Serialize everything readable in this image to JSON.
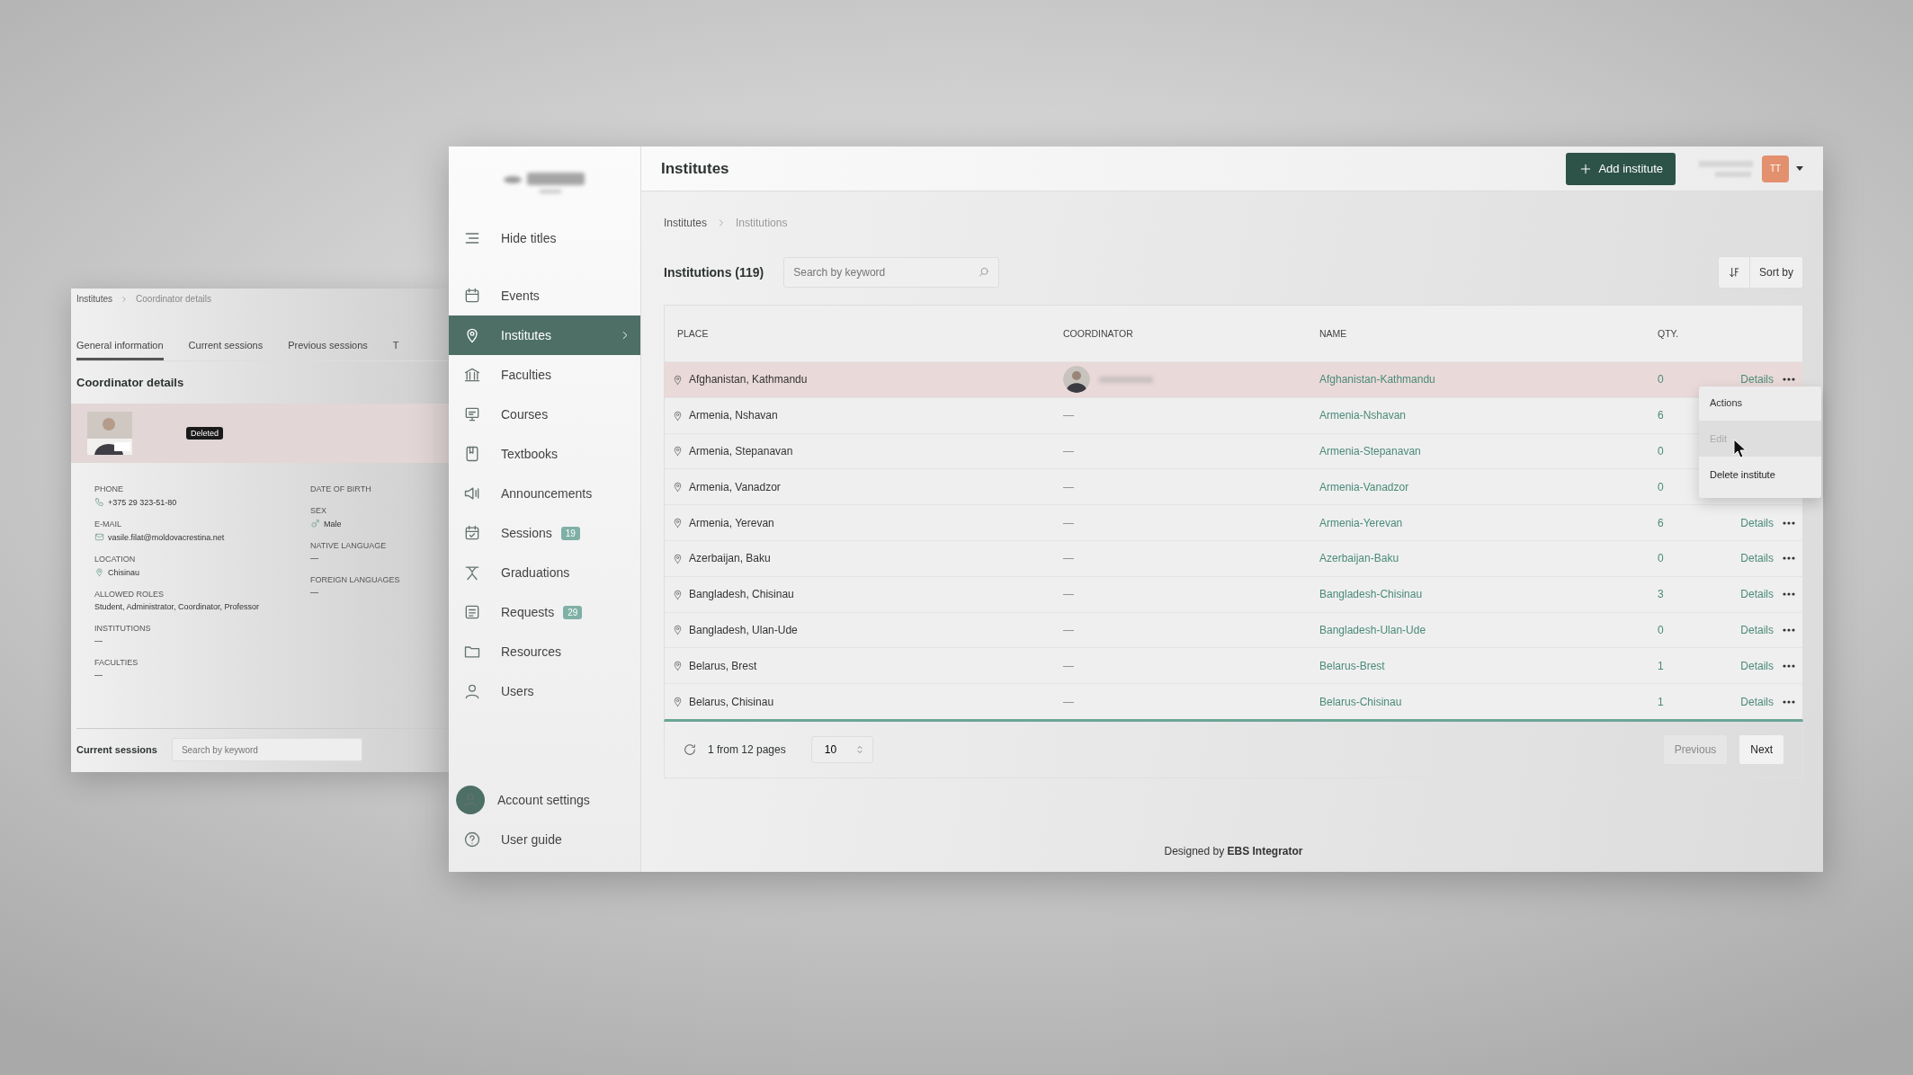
{
  "back_window": {
    "breadcrumb": [
      "Institutes",
      "Coordinator details"
    ],
    "tabs": [
      {
        "label": "General information",
        "selected": true
      },
      {
        "label": "Current sessions",
        "selected": false
      },
      {
        "label": "Previous sessions",
        "selected": false
      },
      {
        "label": "T",
        "selected": false
      }
    ],
    "section_title": "Coordinator details",
    "profile": {
      "badge": "Deleted"
    },
    "fields_left": [
      {
        "label": "PHONE",
        "value": "+375 29 323-51-80"
      },
      {
        "label": "E-MAIL",
        "value": "vasile.filat@moldovacrestina.net"
      },
      {
        "label": "LOCATION",
        "value": "Chisinau"
      },
      {
        "label": "ALLOWED ROLES",
        "value": "Student, Administrator, Coordinator, Professor"
      },
      {
        "label": "INSTITUTIONS",
        "value": "—"
      },
      {
        "label": "FACULTIES",
        "value": "—"
      }
    ],
    "fields_right": [
      {
        "label": "DATE OF BIRTH"
      },
      {
        "label": "SEX",
        "value": "Male"
      },
      {
        "label": "NATIVE LANGUAGE",
        "value": "—"
      },
      {
        "label": "FOREIGN LANGUAGES",
        "value": "—"
      }
    ],
    "bottom": {
      "title": "Current sessions",
      "search_placeholder": "Search by keyword"
    }
  },
  "sidebar": {
    "hide_titles": "Hide titles",
    "items": [
      {
        "label": "Events",
        "selected": false
      },
      {
        "label": "Institutes",
        "selected": true
      },
      {
        "label": "Faculties",
        "selected": false
      },
      {
        "label": "Courses",
        "selected": false
      },
      {
        "label": "Textbooks",
        "selected": false
      },
      {
        "label": "Announcements",
        "selected": false
      },
      {
        "label": "Sessions",
        "selected": false,
        "badge": "19"
      },
      {
        "label": "Graduations",
        "selected": false
      },
      {
        "label": "Requests",
        "selected": false,
        "badge": "29"
      },
      {
        "label": "Resources",
        "selected": false
      },
      {
        "label": "Users",
        "selected": false
      }
    ],
    "footer": [
      "Account settings",
      "User guide"
    ]
  },
  "header": {
    "title": "Institutes",
    "add_button": "Add institute",
    "user_initials": "TT"
  },
  "breadcrumb": [
    "Institutes",
    "Institutions"
  ],
  "toolbar": {
    "title": "Institutions (119)",
    "search_placeholder": "Search by keyword",
    "sort_button": "Sort by"
  },
  "table": {
    "columns": [
      "PLACE",
      "COORDINATOR",
      "NAME",
      "QTY."
    ],
    "rows": [
      {
        "place": "Afghanistan, Kathmandu",
        "coordinator": {
          "kind": "avatar"
        },
        "name": "Afghanistan-Kathmandu",
        "qty": "0",
        "details": "Details",
        "selected": true
      },
      {
        "place": "Armenia, Nshavan",
        "coordinator": {
          "kind": "text",
          "text": "—"
        },
        "name": "Armenia-Nshavan",
        "qty": "6",
        "selected": false
      },
      {
        "place": "Armenia, Stepanavan",
        "coordinator": {
          "kind": "text",
          "text": "—"
        },
        "name": "Armenia-Stepanavan",
        "qty": "0",
        "selected": false
      },
      {
        "place": "Armenia, Vanadzor",
        "coordinator": {
          "kind": "text",
          "text": "—"
        },
        "name": "Armenia-Vanadzor",
        "qty": "0",
        "selected": false
      },
      {
        "place": "Armenia, Yerevan",
        "coordinator": {
          "kind": "text",
          "text": "—"
        },
        "name": "Armenia-Yerevan",
        "qty": "6",
        "details": "Details",
        "selected": false
      },
      {
        "place": "Azerbaijan, Baku",
        "coordinator": {
          "kind": "text",
          "text": "—"
        },
        "name": "Azerbaijan-Baku",
        "qty": "0",
        "details": "Details",
        "selected": false
      },
      {
        "place": "Bangladesh, Chisinau",
        "coordinator": {
          "kind": "text",
          "text": "—"
        },
        "name": "Bangladesh-Chisinau",
        "qty": "3",
        "details": "Details",
        "selected": false
      },
      {
        "place": "Bangladesh, Ulan-Ude",
        "coordinator": {
          "kind": "text",
          "text": "—"
        },
        "name": "Bangladesh-Ulan-Ude",
        "qty": "0",
        "details": "Details",
        "selected": false
      },
      {
        "place": "Belarus, Brest",
        "coordinator": {
          "kind": "text",
          "text": "—"
        },
        "name": "Belarus-Brest",
        "qty": "1",
        "details": "Details",
        "selected": false
      },
      {
        "place": "Belarus, Chisinau",
        "coordinator": {
          "kind": "text",
          "text": "—"
        },
        "name": "Belarus-Chisinau",
        "qty": "1",
        "details": "Details",
        "selected": false
      }
    ]
  },
  "action_menu": {
    "title": "Actions",
    "items": [
      {
        "label": "Edit",
        "disabled": true
      },
      {
        "label": "Delete institute",
        "disabled": false
      }
    ]
  },
  "pagination": {
    "info": "1 from 12 pages",
    "page_size": "10",
    "previous": {
      "label": "Previous",
      "disabled": true
    },
    "next": {
      "label": "Next",
      "disabled": false
    }
  },
  "footer": "Designed by **EBS Integrator**"
}
